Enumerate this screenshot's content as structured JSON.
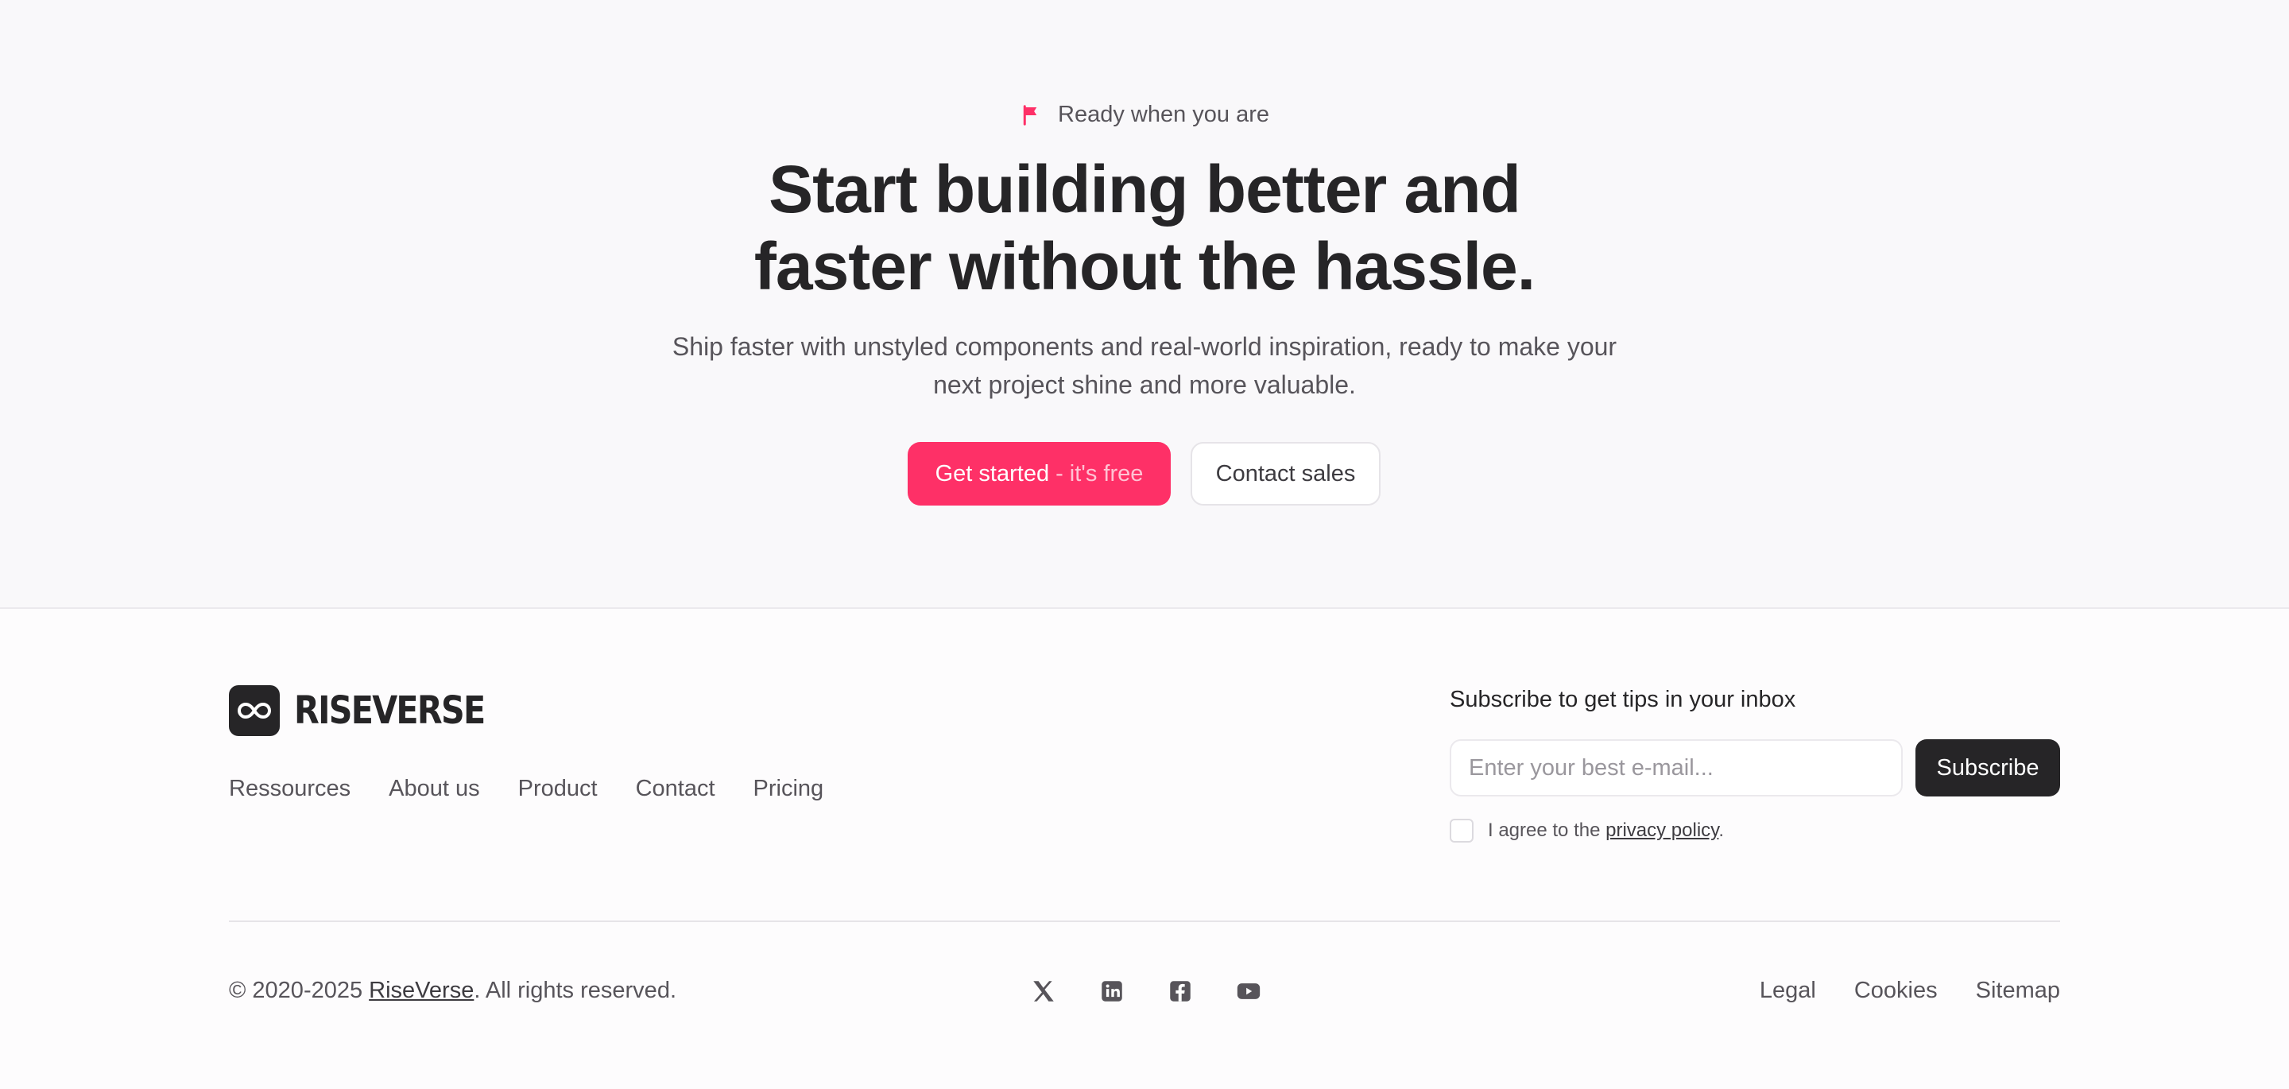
{
  "hero": {
    "eyebrow": "Ready when you are",
    "headline_line1": "Start building better and",
    "headline_line2": "faster without the hassle.",
    "subtitle_line1": "Ship faster with unstyled components and real-world inspiration, ready to make your",
    "subtitle_line2": "next project shine and more valuable.",
    "primary_cta": {
      "label": "Get started",
      "suffix": "- it's free"
    },
    "secondary_cta": "Contact sales",
    "icon": "flag-icon"
  },
  "footer": {
    "brand": "RISEVERSE",
    "brand_icon": "infinity-icon",
    "nav": [
      "Ressources",
      "About us",
      "Product",
      "Contact",
      "Pricing"
    ],
    "subscribe": {
      "title": "Subscribe to get tips in your inbox",
      "placeholder": "Enter your best e-mail...",
      "button": "Subscribe",
      "agree_prefix": "I agree to the",
      "agree_link": "privacy policy",
      "agree_suffix": "."
    },
    "copyright": {
      "prefix": "© 2020-2025",
      "brand": "RiseVerse",
      "suffix": ". All rights reserved."
    },
    "social_icons": [
      "x-icon",
      "linkedin-icon",
      "facebook-icon",
      "youtube-icon"
    ],
    "legal_nav": [
      "Legal",
      "Cookies",
      "Sitemap"
    ]
  },
  "colors": {
    "accent": "#fe3067",
    "dark": "#262527",
    "hero_background": "#f9f8fa"
  }
}
